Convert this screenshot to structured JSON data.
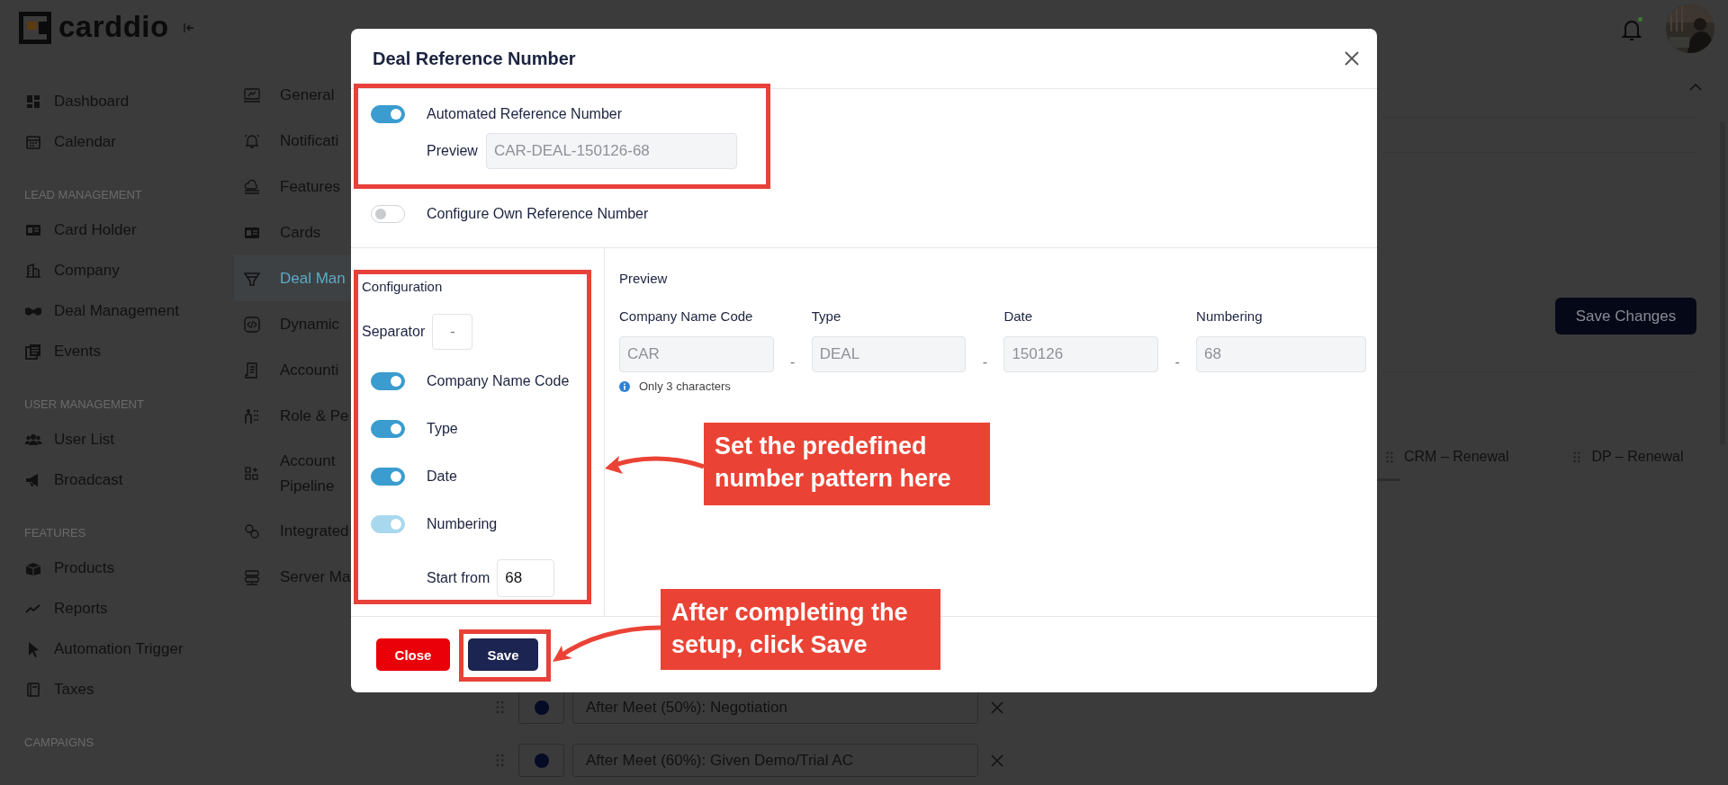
{
  "app": {
    "logo": "carddio"
  },
  "sidebar": {
    "groups": [
      {
        "items": [
          {
            "label": "Dashboard"
          },
          {
            "label": "Calendar"
          }
        ]
      },
      {
        "heading": "LEAD MANAGEMENT",
        "items": [
          {
            "label": "Card Holder"
          },
          {
            "label": "Company"
          },
          {
            "label": "Deal Management"
          },
          {
            "label": "Events"
          }
        ]
      },
      {
        "heading": "USER MANAGEMENT",
        "items": [
          {
            "label": "User List"
          },
          {
            "label": "Broadcast"
          }
        ]
      },
      {
        "heading": "FEATURES",
        "items": [
          {
            "label": "Products"
          },
          {
            "label": "Reports"
          },
          {
            "label": "Automation Trigger"
          },
          {
            "label": "Taxes"
          }
        ]
      },
      {
        "heading": "CAMPAIGNS"
      }
    ]
  },
  "settings_nav": {
    "items": [
      {
        "lines": [
          "General"
        ],
        "selected": false
      },
      {
        "lines": [
          "Notificati"
        ],
        "selected": false
      },
      {
        "lines": [
          "Features"
        ],
        "selected": false
      },
      {
        "lines": [
          "Cards"
        ],
        "selected": false
      },
      {
        "lines": [
          "Deal Man"
        ],
        "selected": true
      },
      {
        "lines": [
          "Dynamic"
        ],
        "selected": false
      },
      {
        "lines": [
          "Accounti"
        ],
        "selected": false
      },
      {
        "lines": [
          "Role & Pe"
        ],
        "selected": false
      },
      {
        "lines": [
          "Account",
          "Pipeline"
        ],
        "selected": false
      },
      {
        "lines": [
          "Integrated"
        ],
        "selected": false
      },
      {
        "lines": [
          "Server Ma"
        ],
        "selected": false
      }
    ]
  },
  "header": {
    "bell_unread": true
  },
  "page": {
    "save_button": "Save Changes",
    "stages": [
      {
        "label": "CRM – Renewal"
      },
      {
        "label": "DP – Renewal"
      }
    ],
    "pipeline_rows": [
      {
        "label": "After Meet (50%): Negotiation"
      },
      {
        "label": "After Meet (60%): Given Demo/Trial AC"
      }
    ]
  },
  "modal": {
    "title": "Deal Reference Number",
    "modes": [
      {
        "label": "Automated Reference Number",
        "on": true
      },
      {
        "label": "Configure Own Reference Number",
        "on": false
      }
    ],
    "preview": {
      "label": "Preview",
      "value": "CAR-DEAL-150126-68"
    },
    "configuration": {
      "title": "Configuration",
      "separator": {
        "label": "Separator",
        "value": "-"
      },
      "parts": [
        {
          "label": "Company Name Code",
          "on": true,
          "disabled": false
        },
        {
          "label": "Type",
          "on": true,
          "disabled": false
        },
        {
          "label": "Date",
          "on": true,
          "disabled": false
        },
        {
          "label": "Numbering",
          "on": true,
          "disabled": true
        }
      ],
      "start_from": {
        "label": "Start from",
        "value": "68"
      }
    },
    "pattern_preview": {
      "title": "Preview",
      "fields": [
        {
          "label": "Company Name Code",
          "value": "CAR"
        },
        {
          "label": "Type",
          "value": "DEAL",
          "joiner": "-"
        },
        {
          "label": "Date",
          "value": "150126",
          "joiner": "-"
        },
        {
          "label": "Numbering",
          "value": "68",
          "joiner": "-"
        }
      ],
      "note": "Only 3 characters"
    },
    "buttons": [
      {
        "label": "Close",
        "kind": "danger"
      },
      {
        "label": "Save",
        "kind": "primary"
      }
    ]
  },
  "annotations": [
    {
      "text": "Set the predefined number pattern here"
    },
    {
      "text": "After completing the setup, click Save"
    }
  ]
}
